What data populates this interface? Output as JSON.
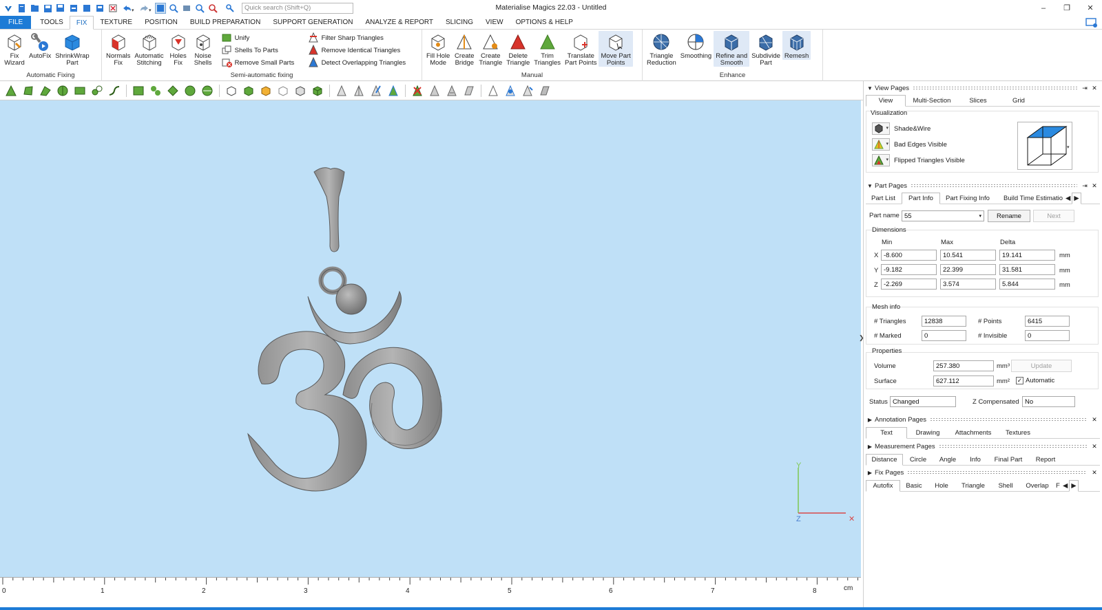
{
  "window": {
    "title": "Materialise Magics 22.03 - Untitled",
    "search_placeholder": "Quick search (Shift+Q)",
    "controls": [
      "–",
      "❐",
      "✕"
    ]
  },
  "menu": {
    "tabs": [
      "FILE",
      "TOOLS",
      "FIX",
      "TEXTURE",
      "POSITION",
      "BUILD PREPARATION",
      "SUPPORT GENERATION",
      "ANALYZE & REPORT",
      "SLICING",
      "VIEW",
      "OPTIONS & HELP"
    ],
    "active": "FIX"
  },
  "ribbon": {
    "automatic": {
      "label": "Automatic Fixing",
      "buttons": [
        "Fix\nWizard",
        "AutoFix",
        "ShrinkWrap\nPart"
      ]
    },
    "semi": {
      "label": "Semi-automatic fixing",
      "buttons": [
        "Normals\nFix",
        "Automatic\nStitching",
        "Holes\nFix",
        "Noise\nShells"
      ],
      "small": [
        "Unify",
        "Shells To Parts",
        "Remove Small Parts"
      ],
      "filters": [
        "Filter Sharp Triangles",
        "Remove Identical Triangles",
        "Detect Overlapping Triangles"
      ]
    },
    "manual": {
      "label": "Manual",
      "buttons": [
        "Fill Hole\nMode",
        "Create\nBridge",
        "Create\nTriangle",
        "Delete\nTriangle",
        "Trim\nTriangles",
        "Translate\nPart Points",
        "Move Part\nPoints"
      ]
    },
    "enhance": {
      "label": "Enhance",
      "buttons": [
        "Triangle\nReduction",
        "Smoothing",
        "Refine and\nSmooth",
        "Subdivide\nPart",
        "Remesh"
      ]
    }
  },
  "viewport": {
    "axes": {
      "y": "Y",
      "z": "Z",
      "x": "✕"
    },
    "ruler": {
      "labels": [
        "0",
        "1",
        "2",
        "3",
        "4",
        "5",
        "6",
        "7",
        "8"
      ],
      "unit": "cm"
    }
  },
  "view_pages": {
    "title": "View Pages",
    "tabs": [
      "View",
      "Multi-Section",
      "Slices",
      "Grid"
    ],
    "active": "View",
    "section": "Visualization",
    "items": [
      "Shade&Wire",
      "Bad Edges Visible",
      "Flipped Triangles Visible"
    ]
  },
  "part_pages": {
    "title": "Part Pages",
    "tabs": [
      "Part List",
      "Part Info",
      "Part Fixing Info",
      "Build Time Estimatio"
    ],
    "active": "Part Info",
    "part_name_label": "Part name",
    "part_name": "55",
    "rename": "Rename",
    "next": "Next",
    "dimensions": {
      "title": "Dimensions",
      "headers": [
        "Min",
        "Max",
        "Delta"
      ],
      "rows": [
        {
          "axis": "X",
          "min": "-8.600",
          "max": "10.541",
          "delta": "19.141",
          "unit": "mm"
        },
        {
          "axis": "Y",
          "min": "-9.182",
          "max": "22.399",
          "delta": "31.581",
          "unit": "mm"
        },
        {
          "axis": "Z",
          "min": "-2.269",
          "max": "3.574",
          "delta": "5.844",
          "unit": "mm"
        }
      ]
    },
    "mesh": {
      "title": "Mesh info",
      "triangles_label": "# Triangles",
      "triangles": "12838",
      "points_label": "# Points",
      "points": "6415",
      "marked_label": "# Marked",
      "marked": "0",
      "invisible_label": "# Invisible",
      "invisible": "0"
    },
    "properties": {
      "title": "Properties",
      "volume_label": "Volume",
      "volume": "257.380",
      "volume_unit": "mm³",
      "surface_label": "Surface",
      "surface": "627.112",
      "surface_unit": "mm²",
      "update": "Update",
      "automatic": "Automatic",
      "automatic_checked": true
    },
    "status_label": "Status",
    "status": "Changed",
    "zcomp_label": "Z Compensated",
    "zcomp": "No"
  },
  "annotation_pages": {
    "title": "Annotation Pages",
    "tabs": [
      "Text",
      "Drawing",
      "Attachments",
      "Textures"
    ],
    "active": "Text"
  },
  "measurement_pages": {
    "title": "Measurement Pages",
    "tabs": [
      "Distance",
      "Circle",
      "Angle",
      "Info",
      "Final Part",
      "Report"
    ],
    "active": "Distance"
  },
  "fix_pages": {
    "title": "Fix Pages",
    "tabs": [
      "Autofix",
      "Basic",
      "Hole",
      "Triangle",
      "Shell",
      "Overlap",
      "F"
    ],
    "active": "Autofix"
  }
}
